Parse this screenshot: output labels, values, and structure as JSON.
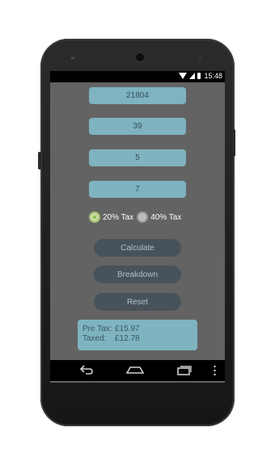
{
  "status_bar": {
    "time": "15:48",
    "icons": [
      "wifi-icon",
      "signal-icon",
      "battery-icon"
    ]
  },
  "inputs": [
    {
      "value": "21804"
    },
    {
      "value": "39"
    },
    {
      "value": "5"
    },
    {
      "value": "7"
    }
  ],
  "tax_options": [
    {
      "label": "20% Tax",
      "selected": true
    },
    {
      "label": "40% Tax",
      "selected": false
    }
  ],
  "buttons": {
    "calculate": "Calculate",
    "breakdown": "Breakdown",
    "reset": "Reset"
  },
  "result": {
    "pre_tax_label": "Pre Tax:",
    "pre_tax_value": "£15.97",
    "taxed_label": "Taxed:",
    "taxed_value": "£12.78"
  },
  "nav_bar": {
    "icons": [
      "back-icon",
      "home-icon",
      "recent-apps-icon",
      "menu-icon"
    ]
  },
  "colors": {
    "screen_bg": "#636363",
    "field_bg": "#7fb3c0",
    "button_bg": "#48525a",
    "radio_selected": "#8bc34a"
  }
}
